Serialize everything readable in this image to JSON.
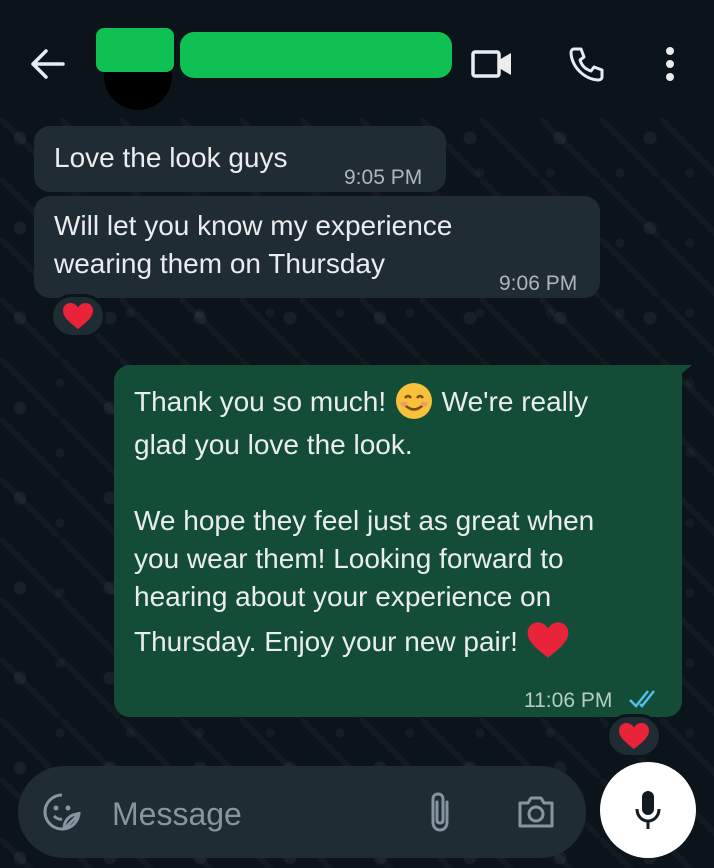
{
  "header": {
    "back_icon": "arrow-left-icon",
    "icons": [
      "video-call-icon",
      "phone-icon",
      "more-vert-icon"
    ]
  },
  "messages": [
    {
      "direction": "incoming",
      "text": "Love the look guys",
      "time": "9:05 PM"
    },
    {
      "direction": "incoming",
      "text_lines": [
        "Will let you know my experience",
        "wearing them on Thursday"
      ],
      "time": "9:06 PM",
      "reaction": "❤️"
    },
    {
      "direction": "outgoing",
      "paragraph1_lines": [
        "Thank you so much! 😊 We're really",
        "glad you love the look."
      ],
      "paragraph2_lines": [
        "We hope they feel just as great when",
        "you wear them! Looking forward to",
        "hearing about your experience on",
        "Thursday. Enjoy your new pair! ❤️"
      ],
      "time": "11:06 PM",
      "status": "read",
      "reaction": "❤️"
    }
  ],
  "composer": {
    "placeholder": "Message",
    "icons": [
      "sticker-icon",
      "attach-icon",
      "camera-icon",
      "mic-icon"
    ]
  },
  "colors": {
    "background": "#0b141a",
    "incoming_bubble": "#202c33",
    "outgoing_bubble": "#144d37",
    "read_ticks": "#53bdeb",
    "redaction": "#0fc152"
  }
}
